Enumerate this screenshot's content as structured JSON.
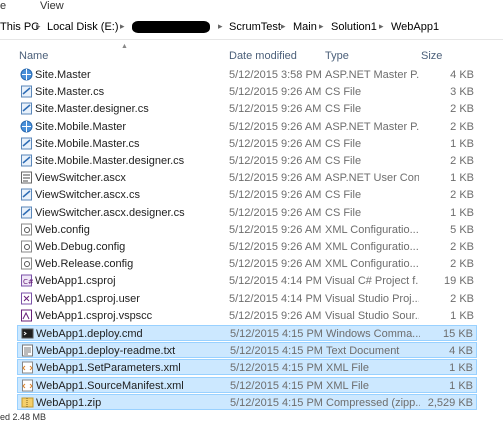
{
  "menubar": {
    "item1": "e",
    "item2": "View"
  },
  "address": {
    "segments": [
      "This PC",
      "Local Disk (E:)",
      "",
      "ScrumTest",
      "Main",
      "Solution1",
      "WebApp1"
    ]
  },
  "columns": {
    "name": "Name",
    "date": "Date modified",
    "type": "Type",
    "size": "Size"
  },
  "files": [
    {
      "name": "Site.Master",
      "date": "5/12/2015 3:58 PM",
      "type": "ASP.NET Master P...",
      "size": "4 KB",
      "icon": "aspnet-master-icon",
      "selected": false
    },
    {
      "name": "Site.Master.cs",
      "date": "5/12/2015 9:26 AM",
      "type": "CS File",
      "size": "3 KB",
      "icon": "cs-file-icon",
      "selected": false
    },
    {
      "name": "Site.Master.designer.cs",
      "date": "5/12/2015 9:26 AM",
      "type": "CS File",
      "size": "2 KB",
      "icon": "cs-file-icon",
      "selected": false
    },
    {
      "name": "Site.Mobile.Master",
      "date": "5/12/2015 9:26 AM",
      "type": "ASP.NET Master P...",
      "size": "2 KB",
      "icon": "aspnet-master-icon",
      "selected": false
    },
    {
      "name": "Site.Mobile.Master.cs",
      "date": "5/12/2015 9:26 AM",
      "type": "CS File",
      "size": "1 KB",
      "icon": "cs-file-icon",
      "selected": false
    },
    {
      "name": "Site.Mobile.Master.designer.cs",
      "date": "5/12/2015 9:26 AM",
      "type": "CS File",
      "size": "2 KB",
      "icon": "cs-file-icon",
      "selected": false
    },
    {
      "name": "ViewSwitcher.ascx",
      "date": "5/12/2015 9:26 AM",
      "type": "ASP.NET User Con...",
      "size": "1 KB",
      "icon": "user-control-icon",
      "selected": false
    },
    {
      "name": "ViewSwitcher.ascx.cs",
      "date": "5/12/2015 9:26 AM",
      "type": "CS File",
      "size": "2 KB",
      "icon": "cs-file-icon",
      "selected": false
    },
    {
      "name": "ViewSwitcher.ascx.designer.cs",
      "date": "5/12/2015 9:26 AM",
      "type": "CS File",
      "size": "1 KB",
      "icon": "cs-file-icon",
      "selected": false
    },
    {
      "name": "Web.config",
      "date": "5/12/2015 9:26 AM",
      "type": "XML Configuratio...",
      "size": "5 KB",
      "icon": "config-file-icon",
      "selected": false
    },
    {
      "name": "Web.Debug.config",
      "date": "5/12/2015 9:26 AM",
      "type": "XML Configuratio...",
      "size": "2 KB",
      "icon": "config-file-icon",
      "selected": false
    },
    {
      "name": "Web.Release.config",
      "date": "5/12/2015 9:26 AM",
      "type": "XML Configuratio...",
      "size": "2 KB",
      "icon": "config-file-icon",
      "selected": false
    },
    {
      "name": "WebApp1.csproj",
      "date": "5/12/2015 4:14 PM",
      "type": "Visual C# Project f...",
      "size": "19 KB",
      "icon": "csproj-icon",
      "selected": false
    },
    {
      "name": "WebApp1.csproj.user",
      "date": "5/12/2015 4:14 PM",
      "type": "Visual Studio Proj...",
      "size": "2 KB",
      "icon": "vs-project-icon",
      "selected": false
    },
    {
      "name": "WebApp1.csproj.vspscc",
      "date": "5/12/2015 9:26 AM",
      "type": "Visual Studio Sour...",
      "size": "1 KB",
      "icon": "vs-source-icon",
      "selected": false
    },
    {
      "name": "WebApp1.deploy.cmd",
      "date": "5/12/2015 4:15 PM",
      "type": "Windows Comma...",
      "size": "15 KB",
      "icon": "cmd-file-icon",
      "selected": true
    },
    {
      "name": "WebApp1.deploy-readme.txt",
      "date": "5/12/2015 4:15 PM",
      "type": "Text Document",
      "size": "4 KB",
      "icon": "text-file-icon",
      "selected": true
    },
    {
      "name": "WebApp1.SetParameters.xml",
      "date": "5/12/2015 4:15 PM",
      "type": "XML File",
      "size": "1 KB",
      "icon": "xml-file-icon",
      "selected": true
    },
    {
      "name": "WebApp1.SourceManifest.xml",
      "date": "5/12/2015 4:15 PM",
      "type": "XML File",
      "size": "1 KB",
      "icon": "xml-file-icon",
      "selected": true
    },
    {
      "name": "WebApp1.zip",
      "date": "5/12/2015 4:15 PM",
      "type": "Compressed (zipp...",
      "size": "2,529 KB",
      "icon": "zip-file-icon",
      "selected": true
    }
  ],
  "status": {
    "text": "ed  2.48 MB"
  },
  "colors": {
    "selection_bg": "#cce8ff",
    "selection_border": "#99d1ff",
    "header_text": "#4c607a"
  }
}
